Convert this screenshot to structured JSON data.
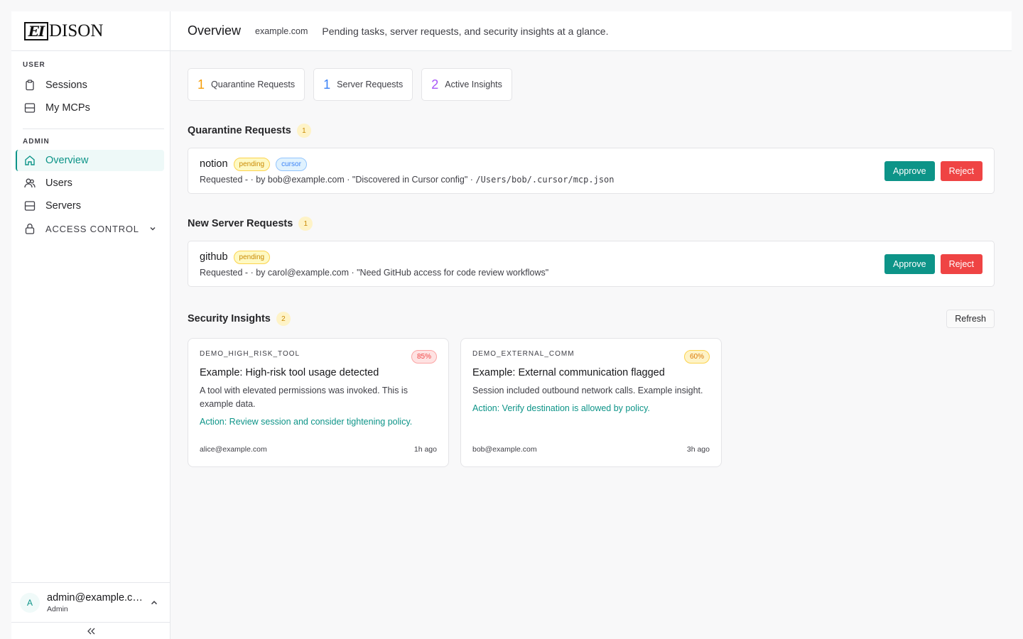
{
  "brand": {
    "logo_mark": "EI",
    "logo_text": "DISON"
  },
  "sidebar": {
    "user_section": "USER",
    "user_items": [
      {
        "label": "Sessions",
        "icon": "clipboard-icon"
      },
      {
        "label": "My MCPs",
        "icon": "server-icon"
      }
    ],
    "admin_section": "ADMIN",
    "admin_items": [
      {
        "label": "Overview",
        "icon": "home-icon",
        "active": true
      },
      {
        "label": "Users",
        "icon": "users-icon"
      },
      {
        "label": "Servers",
        "icon": "server-icon"
      },
      {
        "label": "ACCESS CONTROL",
        "icon": "lock-icon"
      }
    ],
    "account": {
      "avatar": "A",
      "email": "admin@example.com",
      "role": "Admin"
    }
  },
  "header": {
    "title": "Overview",
    "domain": "example.com",
    "subtitle": "Pending tasks, server requests, and security insights at a glance."
  },
  "stats": [
    {
      "count": "1",
      "label": "Quarantine Requests",
      "color": "#f59e0b"
    },
    {
      "count": "1",
      "label": "Server Requests",
      "color": "#3b82f6"
    },
    {
      "count": "2",
      "label": "Active Insights",
      "color": "#a855f7"
    }
  ],
  "quarantine": {
    "title": "Quarantine Requests",
    "count": "1",
    "items": [
      {
        "name": "notion",
        "status": "pending",
        "source": "cursor",
        "requested": "Requested -",
        "by": "by bob@example.com",
        "note": "\"Discovered in Cursor config\"",
        "path": "/Users/bob/.cursor/mcp.json"
      }
    ]
  },
  "server_requests": {
    "title": "New Server Requests",
    "count": "1",
    "items": [
      {
        "name": "github",
        "status": "pending",
        "requested": "Requested -",
        "by": "by carol@example.com",
        "note": "\"Need GitHub access for code review workflows\""
      }
    ]
  },
  "actions": {
    "approve": "Approve",
    "reject": "Reject"
  },
  "insights": {
    "title": "Security Insights",
    "count": "2",
    "refresh": "Refresh",
    "items": [
      {
        "code": "DEMO_HIGH_RISK_TOOL",
        "confidence": "85%",
        "title": "Example: High-risk tool usage detected",
        "description": "A tool with elevated permissions was invoked. This is example data.",
        "action": "Action: Review session and consider tightening policy.",
        "user": "alice@example.com",
        "time": "1h ago"
      },
      {
        "code": "DEMO_EXTERNAL_COMM",
        "confidence": "60%",
        "title": "Example: External communication flagged",
        "description": "Session included outbound network calls. Example insight.",
        "action": "Action: Verify destination is allowed by policy.",
        "user": "bob@example.com",
        "time": "3h ago"
      }
    ]
  },
  "colors": {
    "accent": "#0d9488",
    "reject": "#ef4444"
  }
}
